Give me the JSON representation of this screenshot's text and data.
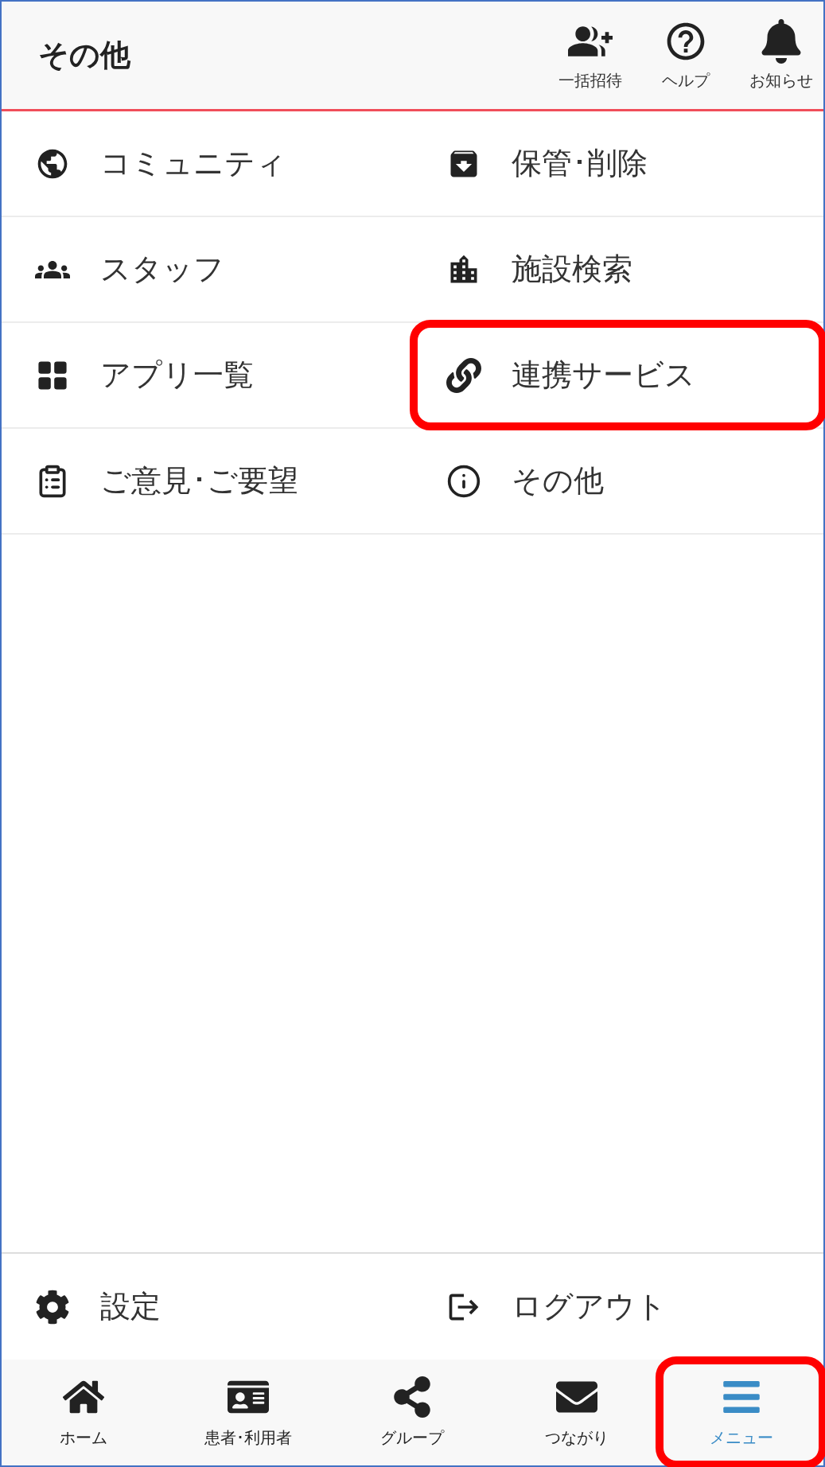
{
  "header": {
    "title": "その他",
    "actions": [
      {
        "label": "一括招待"
      },
      {
        "label": "ヘルプ"
      },
      {
        "label": "お知らせ"
      }
    ]
  },
  "menu": [
    {
      "label": "コミュニティ",
      "highlighted": false
    },
    {
      "label": "保管･削除",
      "highlighted": false
    },
    {
      "label": "スタッフ",
      "highlighted": false
    },
    {
      "label": "施設検索",
      "highlighted": false
    },
    {
      "label": "アプリ一覧",
      "highlighted": false
    },
    {
      "label": "連携サービス",
      "highlighted": true
    },
    {
      "label": "ご意見･ご要望",
      "highlighted": false
    },
    {
      "label": "その他",
      "highlighted": false
    }
  ],
  "footer_menu": [
    {
      "label": "設定"
    },
    {
      "label": "ログアウト"
    }
  ],
  "tabs": [
    {
      "label": "ホーム",
      "selected": false,
      "highlighted": false
    },
    {
      "label": "患者･利用者",
      "selected": false,
      "highlighted": false
    },
    {
      "label": "グループ",
      "selected": false,
      "highlighted": false
    },
    {
      "label": "つながり",
      "selected": false,
      "highlighted": false
    },
    {
      "label": "メニュー",
      "selected": true,
      "highlighted": true
    }
  ]
}
